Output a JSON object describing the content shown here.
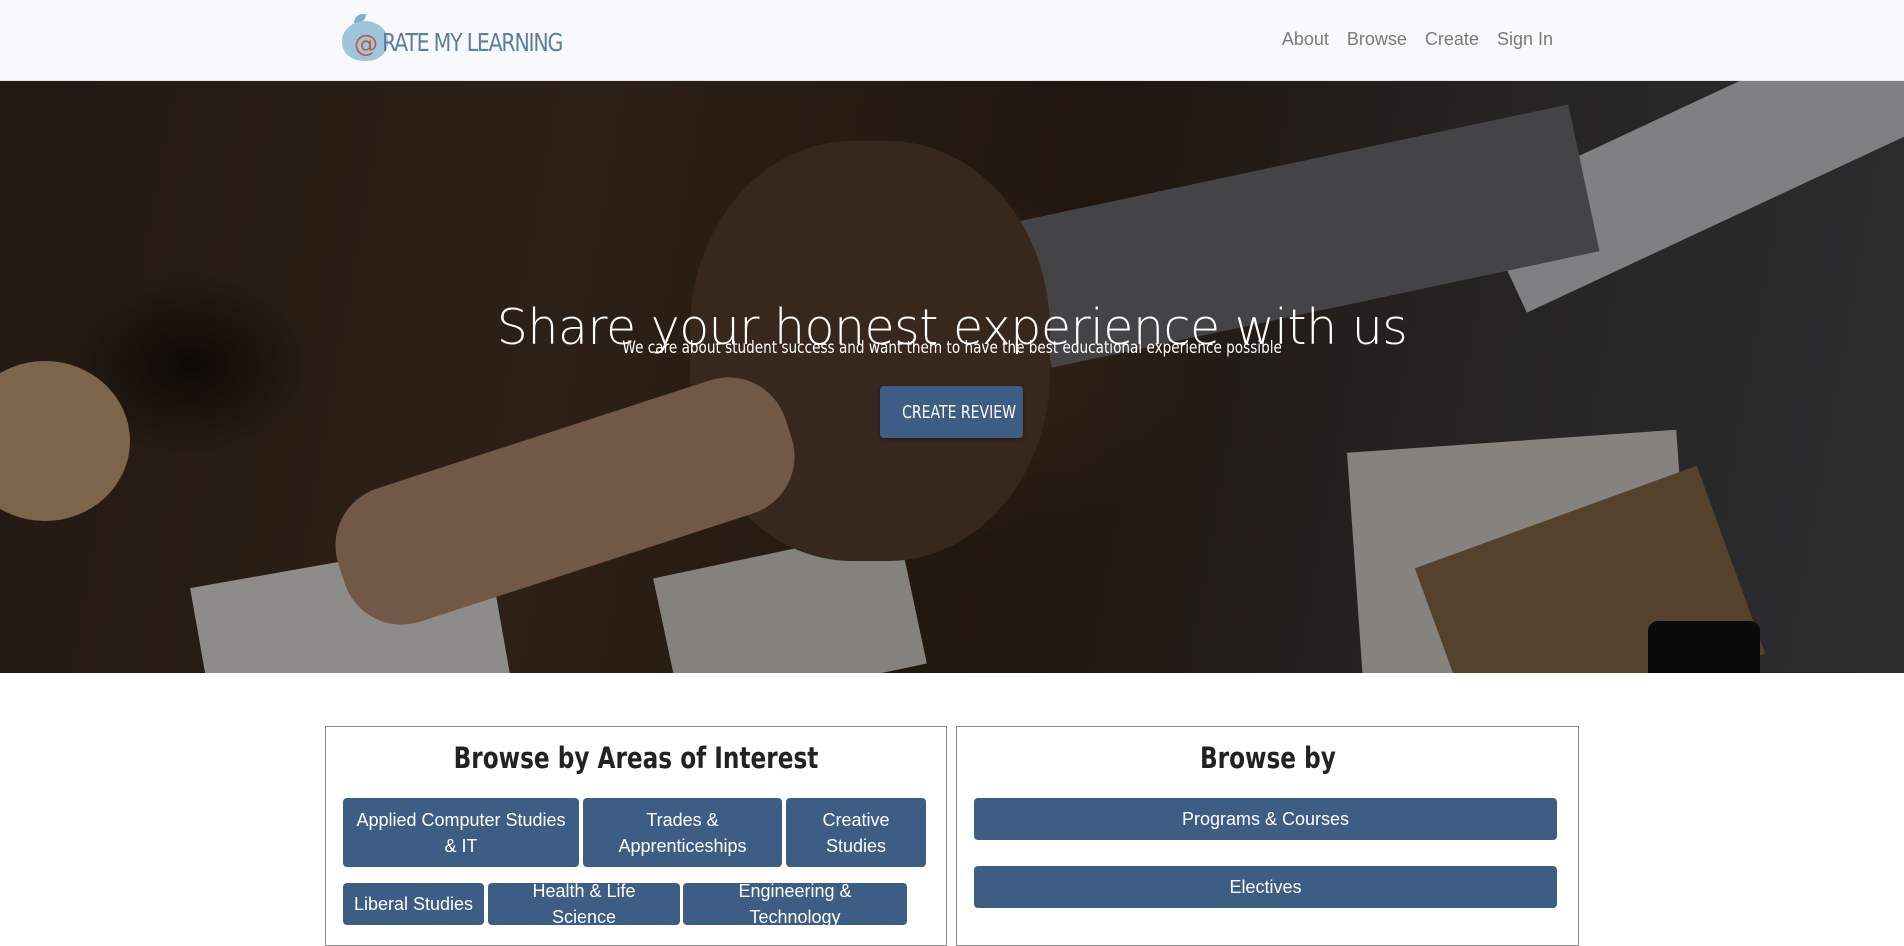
{
  "brand": {
    "logo_text": "RATE MY LEARNING",
    "logo_symbol": "@"
  },
  "nav": {
    "items": [
      "About",
      "Browse",
      "Create",
      "Sign In"
    ]
  },
  "hero": {
    "title": "Share your honest experience with us",
    "subtitle": "We care about student success and want them to have the best educational experience possible",
    "cta_label": "CREATE REVIEW"
  },
  "areas": {
    "title": "Browse by Areas of Interest",
    "buttons": [
      "Applied Computer Studies & IT",
      "Trades & Apprenticeships",
      "Creative Studies",
      "Liberal Studies",
      "Health & Life Science",
      "Engineering & Technology"
    ]
  },
  "browse_by": {
    "title": "Browse by",
    "buttons": [
      "Programs & Courses",
      "Electives"
    ]
  },
  "colors": {
    "primary": "#3e5d85",
    "nav_bg": "#f8f9fa",
    "nav_text": "#7a7a7a",
    "logo": "#5a7fa3"
  }
}
